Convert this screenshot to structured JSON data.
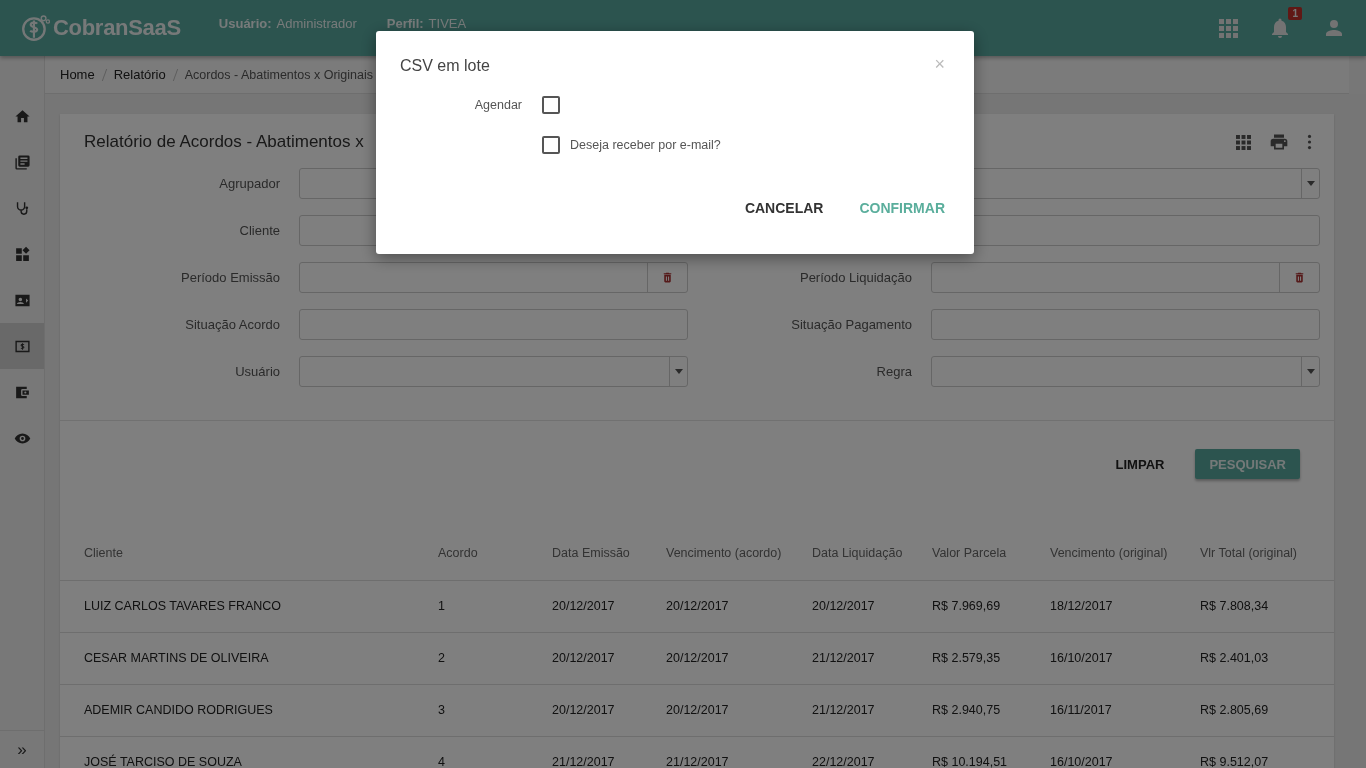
{
  "header": {
    "logo": "CobranSaaS",
    "user_label": "Usuário:",
    "user_value": "Administrador",
    "profile_label": "Perfil:",
    "profile_value": "TIVEA",
    "notification_count": "1"
  },
  "sidebar": {
    "items": [
      {
        "kind": "home",
        "selected": false
      },
      {
        "kind": "books",
        "selected": false
      },
      {
        "kind": "stethoscope",
        "selected": false
      },
      {
        "kind": "widgets",
        "selected": false
      },
      {
        "kind": "contact",
        "selected": false
      },
      {
        "kind": "money",
        "selected": true
      },
      {
        "kind": "wallet",
        "selected": false
      },
      {
        "kind": "eye",
        "selected": false
      }
    ],
    "expand": "»"
  },
  "breadcrumb": [
    "Home",
    "Relatório",
    "Acordos - Abatimentos x Originais"
  ],
  "report": {
    "title": "Relatório de Acordos - Abatimentos x",
    "left_fields": [
      {
        "label": "Agrupador",
        "kind": "select"
      },
      {
        "label": "Cliente",
        "kind": "text"
      },
      {
        "label": "Período Emissão",
        "kind": "date"
      },
      {
        "label": "Situação Acordo",
        "kind": "text"
      },
      {
        "label": "Usuário",
        "kind": "select"
      }
    ],
    "right_fields": [
      {
        "kind": "select"
      },
      {
        "kind": "text"
      },
      {
        "label": "Período Liquidação",
        "kind": "date"
      },
      {
        "label": "Situação Pagamento",
        "kind": "text"
      },
      {
        "label": "Regra",
        "kind": "select"
      }
    ],
    "actions": [
      {
        "label": "LIMPAR",
        "kind": "flat"
      },
      {
        "label": "PESQUISAR",
        "kind": "raised"
      }
    ]
  },
  "table": {
    "columns": [
      "Cliente",
      "Acordo",
      "Data Emissão",
      "Vencimento (acordo)",
      "Data Liquidação",
      "Valor Parcela",
      "Vencimento (original)",
      "Vlr Total (original)"
    ],
    "rows": [
      [
        "LUIZ CARLOS TAVARES FRANCO",
        "1",
        "20/12/2017",
        "20/12/2017",
        "20/12/2017",
        "R$ 7.969,69",
        "18/12/2017",
        "R$ 7.808,34"
      ],
      [
        "CESAR MARTINS DE OLIVEIRA",
        "2",
        "20/12/2017",
        "20/12/2017",
        "21/12/2017",
        "R$ 2.579,35",
        "16/10/2017",
        "R$ 2.401,03"
      ],
      [
        "ADEMIR CANDIDO RODRIGUES",
        "3",
        "20/12/2017",
        "20/12/2017",
        "21/12/2017",
        "R$ 2.940,75",
        "16/11/2017",
        "R$ 2.805,69"
      ],
      [
        "JOSÉ TARCISO DE SOUZA",
        "4",
        "21/12/2017",
        "21/12/2017",
        "22/12/2017",
        "R$ 10.194,51",
        "16/10/2017",
        "R$ 9.512,07"
      ]
    ]
  },
  "dialog": {
    "title": "CSV em lote",
    "close": "×",
    "checkboxes": [
      {
        "label": "Agendar",
        "kind": "label-left",
        "checked": false
      },
      {
        "label": "Deseja receber por e-mail?",
        "kind": "label-right",
        "checked": false
      }
    ],
    "buttons": [
      {
        "label": "CANCELAR",
        "kind": "secondary"
      },
      {
        "label": "CONFIRMAR",
        "kind": "primary"
      }
    ]
  }
}
